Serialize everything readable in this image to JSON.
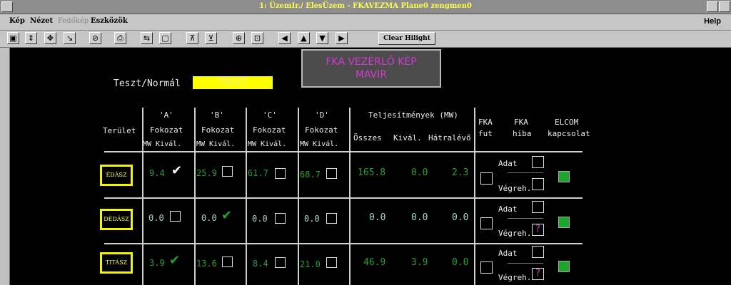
{
  "window": {
    "title": "1: ÜzemIr./ ElesÜzem - FKAVEZMA Plane0   zengmen0"
  },
  "menu": {
    "kep": "Kép",
    "nezet": "Nézet",
    "fedokep": "Fedőkép",
    "eszkozok": "Eszközök",
    "help": "Help"
  },
  "toolbar": {
    "clear": "Clear Hilight"
  },
  "header": {
    "title1": "FKA VEZÉRLŐ KÉP",
    "title2": "MAVIR",
    "mode_label": "Teszt/Normál",
    "mode_value": "TESZT"
  },
  "columns": {
    "terulet": "Terület",
    "a_title": "'A'",
    "b_title": "'B'",
    "c_title": "'C'",
    "d_title": "'D'",
    "fokozat": "Fokozat",
    "mw_kival": "MW  Kivál.",
    "telj": "Teljesítmények (MW)",
    "osszes": "Összes",
    "kival": "Kivál.",
    "hatralevo": "Hátralévő",
    "fka": "FKA",
    "fut": "fut",
    "hiba": "hiba",
    "elcom": "ELCOM",
    "kapcsolat": "kapcsolat",
    "adat": "Adat",
    "vegreh": "Végreh."
  },
  "rows": [
    {
      "area": "ÉDÁSZ",
      "a_mw": "9.4",
      "b_mw": "25.9",
      "c_mw": "61.7",
      "d_mw": "68.7",
      "osszes": "165.8",
      "kival": "0.0",
      "hatra": "2.3"
    },
    {
      "area": "DÉDÁSZ",
      "a_mw": "0.0",
      "b_mw": "0.0",
      "c_mw": "0.0",
      "d_mw": "0.0",
      "osszes": "0.0",
      "kival": "0.0",
      "hatra": "0.0"
    },
    {
      "area": "TITÁSZ",
      "a_mw": "3.9",
      "b_mw": "13.6",
      "c_mw": "8.4",
      "d_mw": "21.0",
      "osszes": "46.9",
      "kival": "3.9",
      "hatra": "0.0"
    }
  ],
  "colors": {
    "accent_yellow": "#f4f400",
    "value_green": "#20a02f",
    "magenta": "#d23bd2",
    "status_green": "#1ca52d"
  }
}
